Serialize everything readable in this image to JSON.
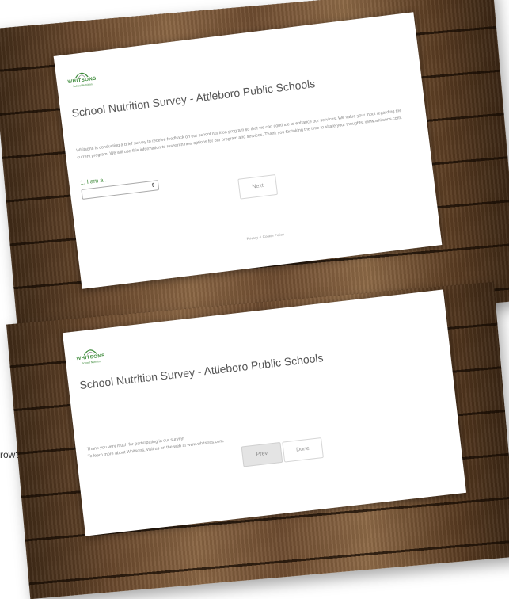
{
  "edge_text": "row?",
  "brand": {
    "logo_name": "WHITSONS",
    "logo_tagline": "School Nutrition",
    "color": "#3d8a3a"
  },
  "screen1": {
    "title": "School Nutrition Survey - Attleboro Public Schools",
    "intro": "Whitsons is conducting a brief survey to receive feedback on our school nutrition program so that we can continue to enhance our services. We value your input regarding the current program. We will use this information to research new options for our program and services. Thank you for taking the time to share your thoughts! www.whitsons.com.",
    "question_label": "1. I am a...",
    "select_value": "",
    "next_label": "Next",
    "privacy_label": "Privacy & Cookie Policy"
  },
  "screen2": {
    "title": "School Nutrition Survey - Attleboro Public Schools",
    "thanks_line1": "Thank you very much for participating in our survey!",
    "thanks_line2": "To learn more about Whitsons, visit us on the web at www.whitsons.com.",
    "prev_label": "Prev",
    "done_label": "Done"
  }
}
